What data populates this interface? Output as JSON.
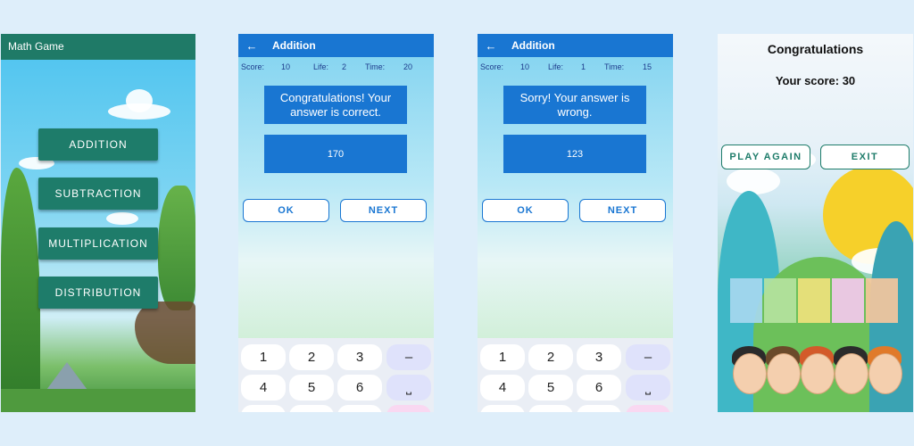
{
  "menu": {
    "app_title": "Math Game",
    "buttons": [
      "ADDITION",
      "SUBTRACTION",
      "MULTIPLICATION",
      "DISTRIBUTION"
    ]
  },
  "correct_screen": {
    "title": "Addition",
    "back_icon": "arrow-back-icon",
    "score_label": "Score:",
    "score": "10",
    "life_label": "Life:",
    "life": "2",
    "time_label": "Time:",
    "time": "20",
    "message": "Congratulations! Your answer is correct.",
    "answer": "170",
    "ok_label": "OK",
    "next_label": "NEXT"
  },
  "wrong_screen": {
    "title": "Addition",
    "back_icon": "arrow-back-icon",
    "score_label": "Score:",
    "score": "10",
    "life_label": "Life:",
    "life": "1",
    "time_label": "Time:",
    "time": "15",
    "message": "Sorry! Your answer is wrong.",
    "answer": "123",
    "ok_label": "OK",
    "next_label": "NEXT"
  },
  "keyboard": {
    "row1": [
      "1",
      "2",
      "3",
      "–"
    ],
    "row2": [
      "4",
      "5",
      "6",
      "⎵"
    ]
  },
  "result_screen": {
    "title": "Congratulations",
    "score_text": "Your score: 30",
    "play_again_label": "PLAY AGAIN",
    "exit_label": "EXIT"
  },
  "colors": {
    "teal_primary": "#1e7c6a",
    "blue_primary": "#1976d2",
    "page_background": "#deeefa"
  }
}
